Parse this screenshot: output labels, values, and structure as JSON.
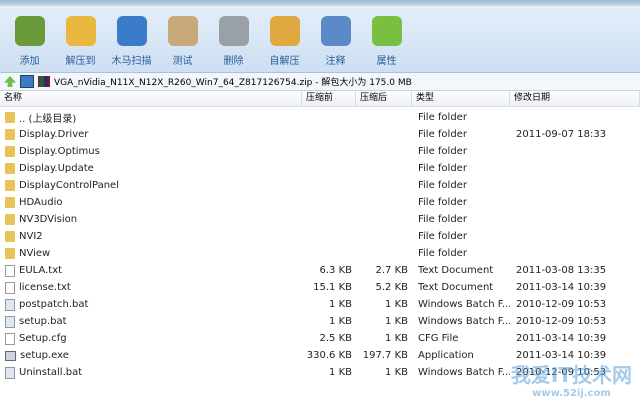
{
  "toolbar": [
    {
      "label": "添加",
      "icon": "add-archive-icon",
      "color": "#6a9a3a"
    },
    {
      "label": "解压到",
      "icon": "extract-icon",
      "color": "#e8b840"
    },
    {
      "label": "木马扫描",
      "icon": "shield-icon",
      "color": "#3a7cc8"
    },
    {
      "label": "测试",
      "icon": "test-checklist-icon",
      "color": "#c8a878"
    },
    {
      "label": "删除",
      "icon": "trash-icon",
      "color": "#9aa0a8"
    },
    {
      "label": "自解压",
      "icon": "sfx-icon",
      "color": "#e0a840"
    },
    {
      "label": "注释",
      "icon": "comment-icon",
      "color": "#5a8ac8"
    },
    {
      "label": "属性",
      "icon": "info-icon",
      "color": "#7ac040"
    }
  ],
  "path": "VGA_nVidia_N11X_N12X_R260_Win7_64_Z817126754.zip - 解包大小为 175.0 MB",
  "columns": [
    "名称",
    "压缩前",
    "压缩后",
    "类型",
    "修改日期"
  ],
  "rows": [
    {
      "name": ".. (上级目录)",
      "before": "",
      "after": "",
      "type": "File folder",
      "date": "",
      "icon": "folder"
    },
    {
      "name": "Display.Driver",
      "before": "",
      "after": "",
      "type": "File folder",
      "date": "2011-09-07 18:33",
      "icon": "folder"
    },
    {
      "name": "Display.Optimus",
      "before": "",
      "after": "",
      "type": "File folder",
      "date": "",
      "icon": "folder"
    },
    {
      "name": "Display.Update",
      "before": "",
      "after": "",
      "type": "File folder",
      "date": "",
      "icon": "folder"
    },
    {
      "name": "DisplayControlPanel",
      "before": "",
      "after": "",
      "type": "File folder",
      "date": "",
      "icon": "folder"
    },
    {
      "name": "HDAudio",
      "before": "",
      "after": "",
      "type": "File folder",
      "date": "",
      "icon": "folder"
    },
    {
      "name": "NV3DVision",
      "before": "",
      "after": "",
      "type": "File folder",
      "date": "",
      "icon": "folder"
    },
    {
      "name": "NVI2",
      "before": "",
      "after": "",
      "type": "File folder",
      "date": "",
      "icon": "folder"
    },
    {
      "name": "NView",
      "before": "",
      "after": "",
      "type": "File folder",
      "date": "",
      "icon": "folder"
    },
    {
      "name": "EULA.txt",
      "before": "6.3 KB",
      "after": "2.7 KB",
      "type": "Text Document",
      "date": "2011-03-08 13:35",
      "icon": "doc"
    },
    {
      "name": "license.txt",
      "before": "15.1 KB",
      "after": "5.2 KB",
      "type": "Text Document",
      "date": "2011-03-14 10:39",
      "icon": "doc"
    },
    {
      "name": "postpatch.bat",
      "before": "1 KB",
      "after": "1 KB",
      "type": "Windows Batch F...",
      "date": "2010-12-09 10:53",
      "icon": "bat"
    },
    {
      "name": "setup.bat",
      "before": "1 KB",
      "after": "1 KB",
      "type": "Windows Batch F...",
      "date": "2010-12-09 10:53",
      "icon": "bat"
    },
    {
      "name": "Setup.cfg",
      "before": "2.5 KB",
      "after": "1 KB",
      "type": "CFG File",
      "date": "2011-03-14 10:39",
      "icon": "doc"
    },
    {
      "name": "setup.exe",
      "before": "330.6 KB",
      "after": "197.7 KB",
      "type": "Application",
      "date": "2011-03-14 10:39",
      "icon": "exe"
    },
    {
      "name": "Uninstall.bat",
      "before": "1 KB",
      "after": "1 KB",
      "type": "Windows Batch F...",
      "date": "2010-12-09 10:53",
      "icon": "bat"
    }
  ],
  "watermark": {
    "text": "我爱IT技术网",
    "url": "www.52ij.com"
  }
}
